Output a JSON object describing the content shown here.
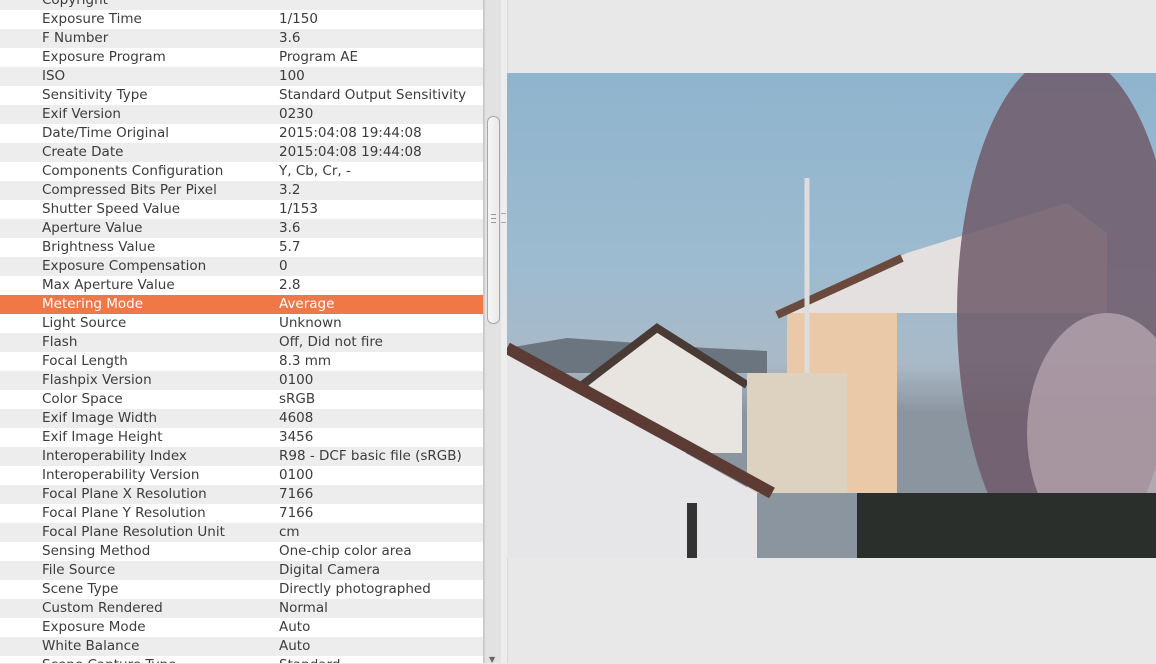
{
  "exif_rows": [
    {
      "key": "Copyright",
      "value": ""
    },
    {
      "key": "Exposure Time",
      "value": "1/150"
    },
    {
      "key": "F Number",
      "value": "3.6"
    },
    {
      "key": "Exposure Program",
      "value": "Program AE"
    },
    {
      "key": "ISO",
      "value": "100"
    },
    {
      "key": "Sensitivity Type",
      "value": "Standard Output Sensitivity"
    },
    {
      "key": "Exif Version",
      "value": "0230"
    },
    {
      "key": "Date/Time Original",
      "value": "2015:04:08 19:44:08"
    },
    {
      "key": "Create Date",
      "value": "2015:04:08 19:44:08"
    },
    {
      "key": "Components Configuration",
      "value": "Y, Cb, Cr, -"
    },
    {
      "key": "Compressed Bits Per Pixel",
      "value": "3.2"
    },
    {
      "key": "Shutter Speed Value",
      "value": "1/153"
    },
    {
      "key": "Aperture Value",
      "value": "3.6"
    },
    {
      "key": "Brightness Value",
      "value": "5.7"
    },
    {
      "key": "Exposure Compensation",
      "value": "0"
    },
    {
      "key": "Max Aperture Value",
      "value": "2.8"
    },
    {
      "key": "Metering Mode",
      "value": "Average"
    },
    {
      "key": "Light Source",
      "value": "Unknown"
    },
    {
      "key": "Flash",
      "value": "Off, Did not fire"
    },
    {
      "key": "Focal Length",
      "value": "8.3 mm"
    },
    {
      "key": "Flashpix Version",
      "value": "0100"
    },
    {
      "key": "Color Space",
      "value": "sRGB"
    },
    {
      "key": "Exif Image Width",
      "value": "4608"
    },
    {
      "key": "Exif Image Height",
      "value": "3456"
    },
    {
      "key": "Interoperability Index",
      "value": "R98 - DCF basic file (sRGB)"
    },
    {
      "key": "Interoperability Version",
      "value": "0100"
    },
    {
      "key": "Focal Plane X Resolution",
      "value": "7166"
    },
    {
      "key": "Focal Plane Y Resolution",
      "value": "7166"
    },
    {
      "key": "Focal Plane Resolution Unit",
      "value": "cm"
    },
    {
      "key": "Sensing Method",
      "value": "One-chip color area"
    },
    {
      "key": "File Source",
      "value": "Digital Camera"
    },
    {
      "key": "Scene Type",
      "value": "Directly photographed"
    },
    {
      "key": "Custom Rendered",
      "value": "Normal"
    },
    {
      "key": "Exposure Mode",
      "value": "Auto"
    },
    {
      "key": "White Balance",
      "value": "Auto"
    },
    {
      "key": "Scene Capture Type",
      "value": "Standard"
    }
  ],
  "selected_row": "Metering Mode",
  "colors": {
    "selection": "#f07746"
  }
}
